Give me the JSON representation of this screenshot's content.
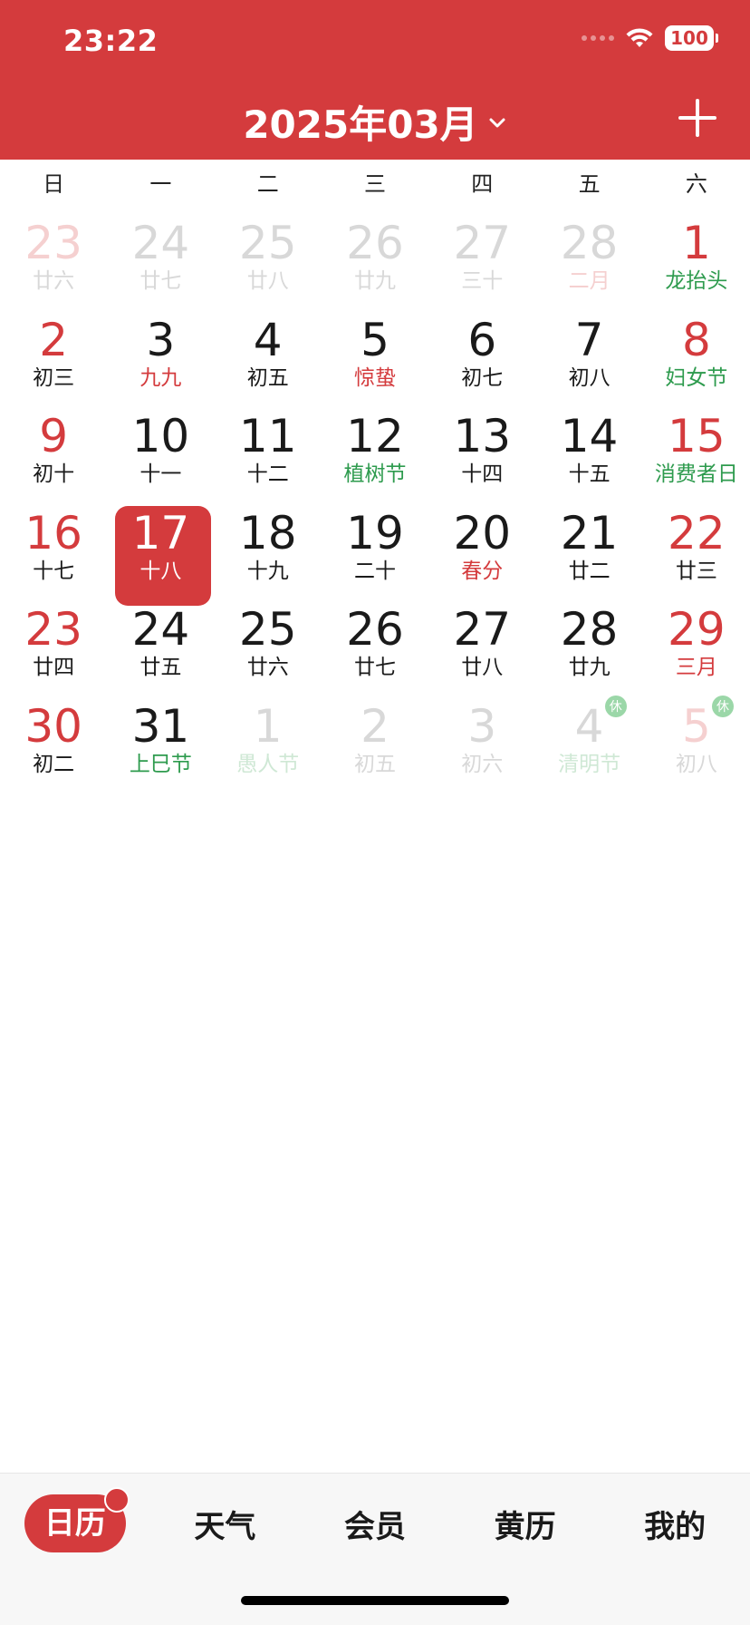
{
  "status": {
    "time": "23:22",
    "battery": "100"
  },
  "header": {
    "month_title": "2025年03月"
  },
  "weekdays": [
    "日",
    "一",
    "二",
    "三",
    "四",
    "五",
    "六"
  ],
  "days": [
    {
      "num": "23",
      "lunar": "廿六",
      "faded": true,
      "weekend": true
    },
    {
      "num": "24",
      "lunar": "廿七",
      "faded": true
    },
    {
      "num": "25",
      "lunar": "廿八",
      "faded": true
    },
    {
      "num": "26",
      "lunar": "廿九",
      "faded": true
    },
    {
      "num": "27",
      "lunar": "三十",
      "faded": true
    },
    {
      "num": "28",
      "lunar": "二月",
      "faded": true,
      "lunar_color": "red"
    },
    {
      "num": "1",
      "lunar": "龙抬头",
      "weekend": true,
      "lunar_color": "green"
    },
    {
      "num": "2",
      "lunar": "初三",
      "weekend": true
    },
    {
      "num": "3",
      "lunar": "九九",
      "lunar_color": "red"
    },
    {
      "num": "4",
      "lunar": "初五"
    },
    {
      "num": "5",
      "lunar": "惊蛰",
      "lunar_color": "red"
    },
    {
      "num": "6",
      "lunar": "初七"
    },
    {
      "num": "7",
      "lunar": "初八"
    },
    {
      "num": "8",
      "lunar": "妇女节",
      "weekend": true,
      "lunar_color": "green"
    },
    {
      "num": "9",
      "lunar": "初十",
      "weekend": true
    },
    {
      "num": "10",
      "lunar": "十一"
    },
    {
      "num": "11",
      "lunar": "十二"
    },
    {
      "num": "12",
      "lunar": "植树节",
      "lunar_color": "green"
    },
    {
      "num": "13",
      "lunar": "十四"
    },
    {
      "num": "14",
      "lunar": "十五"
    },
    {
      "num": "15",
      "lunar": "消费者日",
      "weekend": true,
      "lunar_color": "green"
    },
    {
      "num": "16",
      "lunar": "十七",
      "weekend": true
    },
    {
      "num": "17",
      "lunar": "十八",
      "selected": true
    },
    {
      "num": "18",
      "lunar": "十九"
    },
    {
      "num": "19",
      "lunar": "二十"
    },
    {
      "num": "20",
      "lunar": "春分",
      "lunar_color": "red"
    },
    {
      "num": "21",
      "lunar": "廿二"
    },
    {
      "num": "22",
      "lunar": "廿三",
      "weekend": true
    },
    {
      "num": "23",
      "lunar": "廿四",
      "weekend": true
    },
    {
      "num": "24",
      "lunar": "廿五"
    },
    {
      "num": "25",
      "lunar": "廿六"
    },
    {
      "num": "26",
      "lunar": "廿七"
    },
    {
      "num": "27",
      "lunar": "廿八"
    },
    {
      "num": "28",
      "lunar": "廿九"
    },
    {
      "num": "29",
      "lunar": "三月",
      "weekend": true,
      "lunar_color": "red"
    },
    {
      "num": "30",
      "lunar": "初二",
      "weekend": true
    },
    {
      "num": "31",
      "lunar": "上巳节",
      "lunar_color": "green"
    },
    {
      "num": "1",
      "lunar": "愚人节",
      "faded": true,
      "lunar_color": "green"
    },
    {
      "num": "2",
      "lunar": "初五",
      "faded": true
    },
    {
      "num": "3",
      "lunar": "初六",
      "faded": true
    },
    {
      "num": "4",
      "lunar": "清明节",
      "faded": true,
      "lunar_color": "green",
      "badge": "休"
    },
    {
      "num": "5",
      "lunar": "初八",
      "faded": true,
      "weekend": true,
      "badge": "休"
    }
  ],
  "tabs": [
    {
      "label": "日历",
      "active": true
    },
    {
      "label": "天气"
    },
    {
      "label": "会员"
    },
    {
      "label": "黄历"
    },
    {
      "label": "我的"
    }
  ],
  "colors": {
    "accent": "#D43B3D",
    "holiday_green": "#2E9B4E"
  }
}
